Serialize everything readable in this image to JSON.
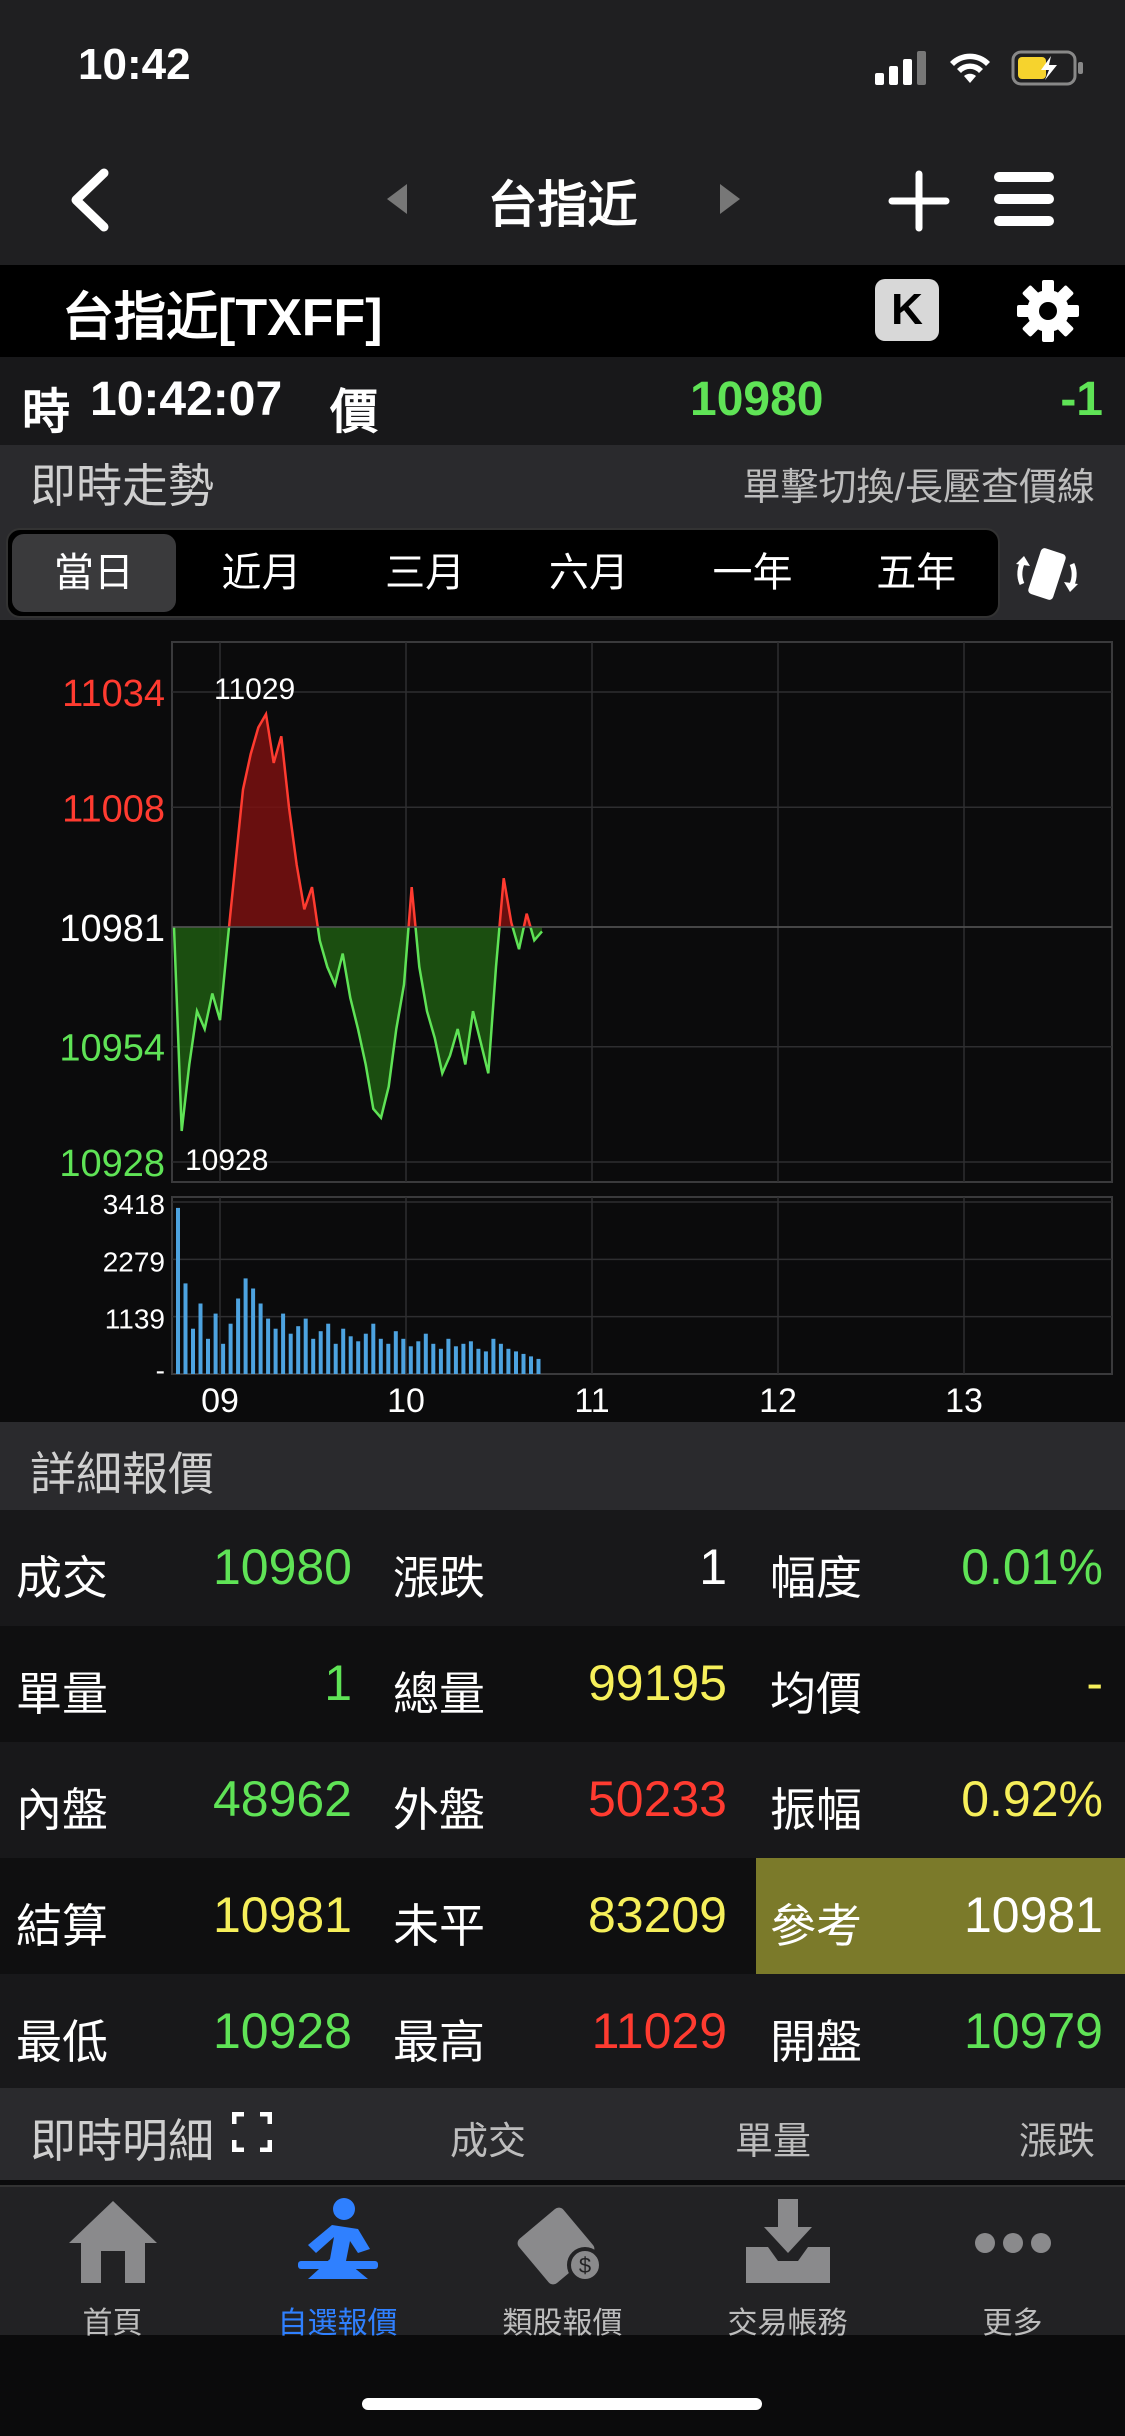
{
  "status_bar": {
    "time": "10:42"
  },
  "nav": {
    "title": "台指近"
  },
  "symbol": {
    "title": "台指近[TXFF]",
    "k_label": "K"
  },
  "quote": {
    "time_label": "時",
    "time": "10:42:07",
    "price_label": "價",
    "price": "10980",
    "change": "-1"
  },
  "trend": {
    "title": "即時走勢",
    "hint": "單擊切換/長壓查價線"
  },
  "tabs": [
    "當日",
    "近月",
    "三月",
    "六月",
    "一年",
    "五年"
  ],
  "chart_data": {
    "type": "line",
    "price_axis_labels": [
      "11034",
      "11008",
      "10981",
      "10954",
      "10928"
    ],
    "reference": 10981,
    "high_label": "11029",
    "low_label": "10928",
    "ylim": [
      10928,
      11034
    ],
    "x_tick_labels": [
      "09",
      "10",
      "11",
      "12",
      "13"
    ],
    "price_series": [
      10981,
      10935,
      10950,
      10962,
      10958,
      10966,
      10960,
      10978,
      10995,
      11012,
      11020,
      11026,
      11029,
      11018,
      11024,
      11008,
      10995,
      10985,
      10990,
      10978,
      10972,
      10968,
      10975,
      10965,
      10958,
      10950,
      10940,
      10938,
      10945,
      10958,
      10968,
      10990,
      10972,
      10962,
      10956,
      10948,
      10952,
      10958,
      10950,
      10962,
      10955,
      10948,
      10972,
      10992,
      10982,
      10976,
      10984,
      10978,
      10980
    ],
    "volume_axis_labels": [
      "3418",
      "2279",
      "1139",
      "-"
    ],
    "volume_series": [
      3300,
      1800,
      900,
      1400,
      700,
      1200,
      600,
      1000,
      1500,
      1900,
      1700,
      1400,
      1100,
      900,
      1200,
      800,
      950,
      1100,
      700,
      850,
      1000,
      600,
      900,
      750,
      650,
      800,
      1000,
      700,
      600,
      850,
      700,
      550,
      650,
      800,
      600,
      500,
      700,
      550,
      600,
      650,
      500,
      450,
      700,
      600,
      500,
      450,
      400,
      350,
      300
    ]
  },
  "detail": {
    "title": "詳細報價",
    "rows": [
      [
        [
          "成交",
          "10980"
        ],
        [
          "漲跌",
          "1"
        ],
        [
          "幅度",
          "0.01%"
        ]
      ],
      [
        [
          "單量",
          "1"
        ],
        [
          "總量",
          "99195"
        ],
        [
          "均價",
          "-"
        ]
      ],
      [
        [
          "內盤",
          "48962"
        ],
        [
          "外盤",
          "50233"
        ],
        [
          "振幅",
          "0.92%"
        ]
      ],
      [
        [
          "結算",
          "10981"
        ],
        [
          "未平",
          "83209"
        ],
        [
          "參考",
          "10981"
        ]
      ],
      [
        [
          "最低",
          "10928"
        ],
        [
          "最高",
          "11029"
        ],
        [
          "開盤",
          "10979"
        ]
      ]
    ]
  },
  "realtime": {
    "title": "即時明細",
    "col_trade": "成交",
    "col_qty": "單量",
    "col_change": "漲跌"
  },
  "bottom_nav": [
    "首頁",
    "自選報價",
    "類股報價",
    "交易帳務",
    "更多"
  ],
  "colors": {
    "up": "#ff3b30",
    "down": "#5fe356",
    "flat": "#ffffff",
    "highlight": "#f6ef5a",
    "active_tab": "#2f80ff"
  }
}
